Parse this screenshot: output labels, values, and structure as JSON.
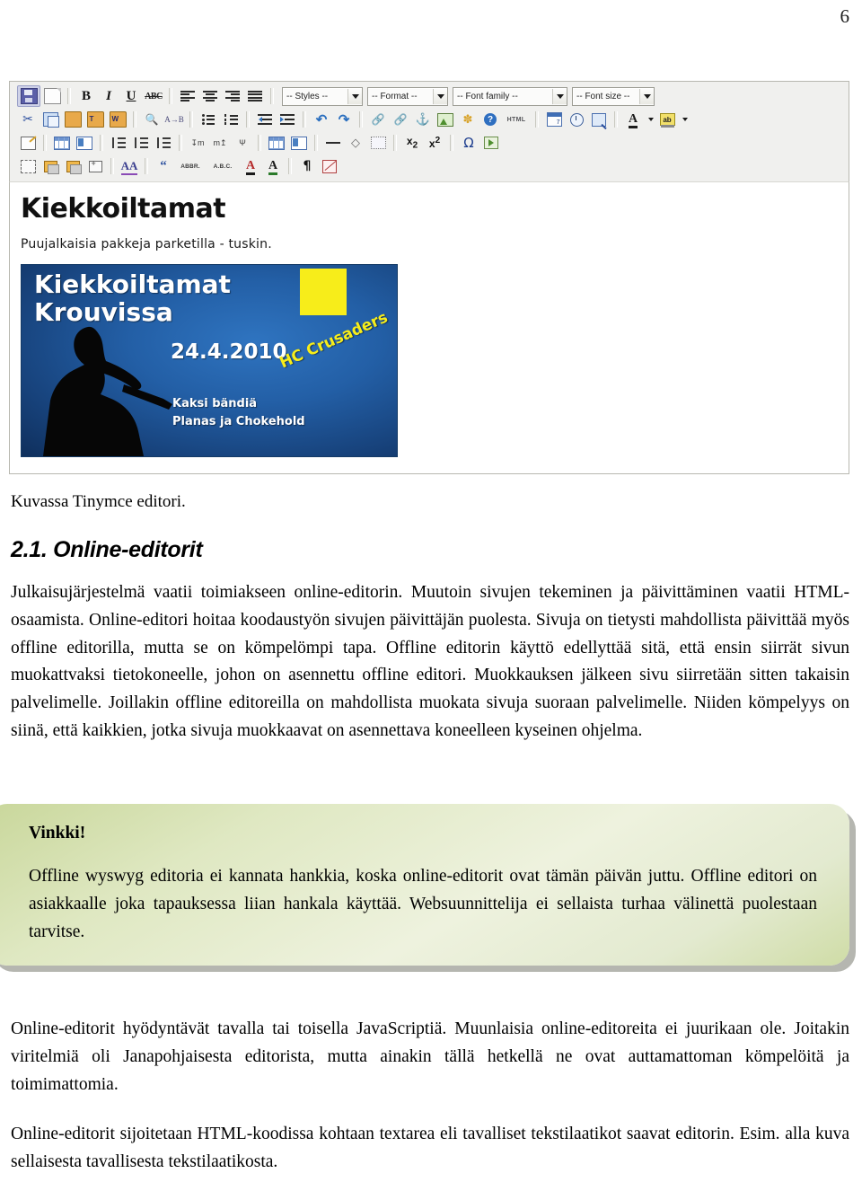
{
  "page": {
    "number": "6"
  },
  "editor": {
    "name": "TinyMCE editor screenshot",
    "toolbar": {
      "row1": [
        {
          "name": "save-button",
          "icon": "save-icon",
          "title": "Save"
        },
        {
          "name": "new-document-button",
          "icon": "new-document-icon",
          "title": "New document"
        },
        {
          "name": "bold-button",
          "icon": "bold-icon",
          "label": "B"
        },
        {
          "name": "italic-button",
          "icon": "italic-icon",
          "label": "I"
        },
        {
          "name": "underline-button",
          "icon": "underline-icon",
          "label": "U"
        },
        {
          "name": "strikethrough-button",
          "icon": "strikethrough-icon",
          "label": "ABC"
        },
        {
          "name": "align-left-button",
          "icon": "align-left-icon"
        },
        {
          "name": "align-center-button",
          "icon": "align-center-icon"
        },
        {
          "name": "align-right-button",
          "icon": "align-right-icon"
        },
        {
          "name": "align-justify-button",
          "icon": "align-justify-icon"
        }
      ],
      "selects": {
        "styles": "-- Styles --",
        "format": "-- Format --",
        "font_family": "-- Font family --",
        "font_size": "-- Font size --"
      },
      "row2": [
        {
          "name": "cut-button",
          "icon": "scissors-icon"
        },
        {
          "name": "copy-button",
          "icon": "copy-icon"
        },
        {
          "name": "paste-button",
          "icon": "paste-icon"
        },
        {
          "name": "paste-as-text-button",
          "icon": "paste-text-icon",
          "label": "T"
        },
        {
          "name": "paste-from-word-button",
          "icon": "paste-word-icon",
          "label": "W"
        },
        {
          "name": "find-button",
          "icon": "binoculars-icon"
        },
        {
          "name": "find-replace-button",
          "icon": "find-replace-icon"
        },
        {
          "name": "bullet-list-button",
          "icon": "bullet-list-icon"
        },
        {
          "name": "numbered-list-button",
          "icon": "numbered-list-icon"
        },
        {
          "name": "outdent-button",
          "icon": "outdent-icon"
        },
        {
          "name": "indent-button",
          "icon": "indent-icon"
        },
        {
          "name": "undo-button",
          "icon": "undo-icon"
        },
        {
          "name": "redo-button",
          "icon": "redo-icon"
        },
        {
          "name": "insert-link-button",
          "icon": "link-icon"
        },
        {
          "name": "unlink-button",
          "icon": "unlink-icon"
        },
        {
          "name": "insert-anchor-button",
          "icon": "anchor-icon"
        },
        {
          "name": "insert-image-button",
          "icon": "image-icon"
        },
        {
          "name": "cleanup-button",
          "icon": "broom-icon"
        },
        {
          "name": "help-button",
          "icon": "help-icon"
        },
        {
          "name": "edit-html-button",
          "icon": "html-icon",
          "label": "HTML"
        },
        {
          "name": "insert-date-button",
          "icon": "calendar-icon"
        },
        {
          "name": "insert-time-button",
          "icon": "clock-icon"
        },
        {
          "name": "preview-button",
          "icon": "preview-icon"
        },
        {
          "name": "text-color-button",
          "icon": "text-color-icon",
          "label": "A"
        },
        {
          "name": "background-color-button",
          "icon": "highlight-color-icon",
          "label": "ab"
        }
      ],
      "row3": [
        {
          "name": "table-properties-button",
          "icon": "table-properties-icon"
        },
        {
          "name": "insert-row-before-button",
          "icon": "row-before-icon"
        },
        {
          "name": "insert-row-after-button",
          "icon": "row-after-icon"
        },
        {
          "name": "delete-row-button",
          "icon": "delete-row-icon"
        },
        {
          "name": "insert-column-before-button",
          "icon": "column-before-icon"
        },
        {
          "name": "insert-column-after-button",
          "icon": "column-after-icon"
        },
        {
          "name": "delete-column-button",
          "icon": "delete-column-icon"
        },
        {
          "name": "split-cells-button",
          "icon": "split-cells-icon"
        },
        {
          "name": "merge-cells-button",
          "icon": "merge-cells-icon"
        },
        {
          "name": "row-properties-button",
          "icon": "row-properties-icon"
        },
        {
          "name": "cell-properties-button",
          "icon": "cell-properties-icon"
        },
        {
          "name": "horizontal-rule-button",
          "icon": "horizontal-rule-icon"
        },
        {
          "name": "remove-formatting-button",
          "icon": "eraser-icon"
        },
        {
          "name": "insert-table-button",
          "icon": "insert-table-icon"
        },
        {
          "name": "subscript-button",
          "icon": "subscript-icon",
          "label": "x2"
        },
        {
          "name": "superscript-button",
          "icon": "superscript-icon",
          "label": "x2"
        },
        {
          "name": "special-character-button",
          "icon": "omega-icon",
          "label": "Ω"
        },
        {
          "name": "insert-media-button",
          "icon": "media-icon"
        }
      ],
      "row4": [
        {
          "name": "select-image-button",
          "icon": "select-image-icon"
        },
        {
          "name": "move-forward-button",
          "icon": "layer-forward-icon"
        },
        {
          "name": "move-backward-button",
          "icon": "layer-backward-icon"
        },
        {
          "name": "insert-layer-button",
          "icon": "insert-layer-icon"
        },
        {
          "name": "styleprops-button",
          "icon": "style-props-icon",
          "label": "AA"
        },
        {
          "name": "blockquote-button",
          "icon": "blockquote-icon"
        },
        {
          "name": "abbreviation-button",
          "icon": "abbr-icon",
          "label": "ABBR."
        },
        {
          "name": "acronym-button",
          "icon": "acronym-icon",
          "label": "A.B.C."
        },
        {
          "name": "deletion-button",
          "icon": "deletion-icon",
          "label": "A"
        },
        {
          "name": "insertion-button",
          "icon": "insertion-icon",
          "label": "A"
        },
        {
          "name": "show-blocks-button",
          "icon": "pilcrow-icon",
          "label": "¶"
        },
        {
          "name": "nonbreaking-button",
          "icon": "nonbreaking-icon"
        }
      ]
    },
    "content": {
      "heading": "Kiekkoiltamat",
      "paragraph": "Puujalkaisia pakkeja parketilla - tuskin.",
      "poster": {
        "title_line1": "Kiekkoiltamat",
        "title_line2": "Krouvissa",
        "date": "24.4.2010",
        "club": "HC Crusaders",
        "bands_line1": "Kaksi bändiä",
        "bands_line2": "Planas ja Chokehold",
        "background_color": "#235fa6",
        "accent_color": "#f7ed1a"
      }
    }
  },
  "document": {
    "caption": "Kuvassa Tinymce editori.",
    "section_heading": "2.1. Online-editorit",
    "paragraph1": "Julkaisujärjestelmä vaatii toimiakseen online-editorin. Muutoin sivujen tekeminen ja päivittäminen vaatii HTML-osaamista. Online-editori hoitaa koodaustyön sivujen päivittäjän puolesta. Sivuja on tietysti mahdollista päivittää myös offline editorilla, mutta se on kömpelömpi tapa. Offline editorin käyttö edellyttää sitä, että ensin siirrät sivun muokattvaksi tietokoneelle, johon on asennettu offline editori. Muokkauksen jälkeen sivu siirretään sitten takaisin palvelimelle. Joillakin offline editoreilla on mahdollista muokata sivuja suoraan palvelimelle. Niiden kömpelyys on siinä, että kaikkien, jotka sivuja muokkaavat on asennettava koneelleen kyseinen ohjelma.",
    "tip": {
      "title": "Vinkki!",
      "text": "Offline wyswyg editoria ei kannata hankkia, koska online-editorit ovat tämän päivän juttu. Offline editori on asiakkaalle joka tapauksessa liian hankala käyttää. Websuunnittelija ei sellaista turhaa välinettä puolestaan tarvitse.",
      "background_color": "#dfe8c2"
    },
    "paragraph2": "Online-editorit hyödyntävät tavalla tai toisella JavaScriptiä. Muunlaisia online-editoreita ei juurikaan ole. Joitakin viritelmiä oli Janapohjaisesta editorista, mutta ainakin tällä hetkellä ne ovat auttamattoman kömpelöitä ja toimimattomia.",
    "paragraph3": "Online-editorit sijoitetaan HTML-koodissa kohtaan textarea eli tavalliset tekstilaatikot saavat editorin. Esim. alla kuva sellaisesta tavallisesta tekstilaatikosta."
  }
}
